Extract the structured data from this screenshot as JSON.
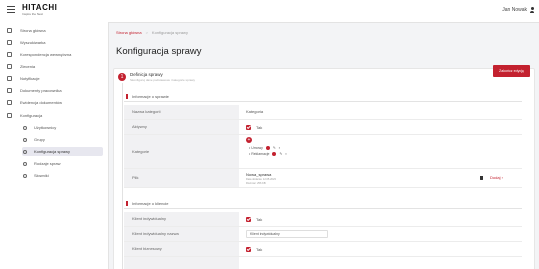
{
  "header": {
    "logo_main": "HITACHI",
    "logo_sub": "Inspire the Next",
    "user_name": "Jan Nowak"
  },
  "sidebar": {
    "items": [
      {
        "label": "Strona główna"
      },
      {
        "label": "Wyszukiwarka"
      },
      {
        "label": "Korespondencja wewnętrzna"
      },
      {
        "label": "Zlecenia"
      },
      {
        "label": "Notyfikacje"
      },
      {
        "label": "Dokumenty pracownika"
      },
      {
        "label": "Ewidencja dokumentów"
      },
      {
        "label": "Konfiguracja"
      }
    ],
    "subitems": [
      {
        "label": "Użytkownicy"
      },
      {
        "label": "Grupy"
      },
      {
        "label": "Konfiguracja sprawy"
      },
      {
        "label": "Rodzaje spraw"
      },
      {
        "label": "Słowniki"
      }
    ]
  },
  "breadcrumb": {
    "home": "Strona główna",
    "current": "Konfiguracja sprawy"
  },
  "page": {
    "title": "Konfiguracja sprawy"
  },
  "step": {
    "number": "1",
    "title": "Definicja sprawy",
    "description": "Skonfiguruj dane podstawowe i kategorie sprawy"
  },
  "actions": {
    "finish_label": "Zakończ edycję"
  },
  "section1": {
    "title": "Informacje o sprawie",
    "rows": {
      "name_label": "Nazwa kategorii",
      "name_value": "Kategoria",
      "active_label": "Aktywny",
      "active_value": "Tak",
      "categories_label": "Kategorie",
      "categories": [
        "Umowy",
        "Reklamacje"
      ],
      "file_label": "Plik",
      "file_name": "Nowa_sprawa",
      "file_meta1": "Data dodania: 12.05.2023",
      "file_meta2": "Rozmiar: 256 KB",
      "browse_label": "Dodaj ›"
    }
  },
  "section2": {
    "title": "Informacje o kliencie",
    "rows": {
      "client_label": "Klient indywidualny",
      "client_value": "Tak",
      "client_name_label": "Klient indywidualny nazwa",
      "client_name_value": "Klient indywidualny",
      "business_label": "Klient biznesowy",
      "business_value": "Tak"
    }
  }
}
